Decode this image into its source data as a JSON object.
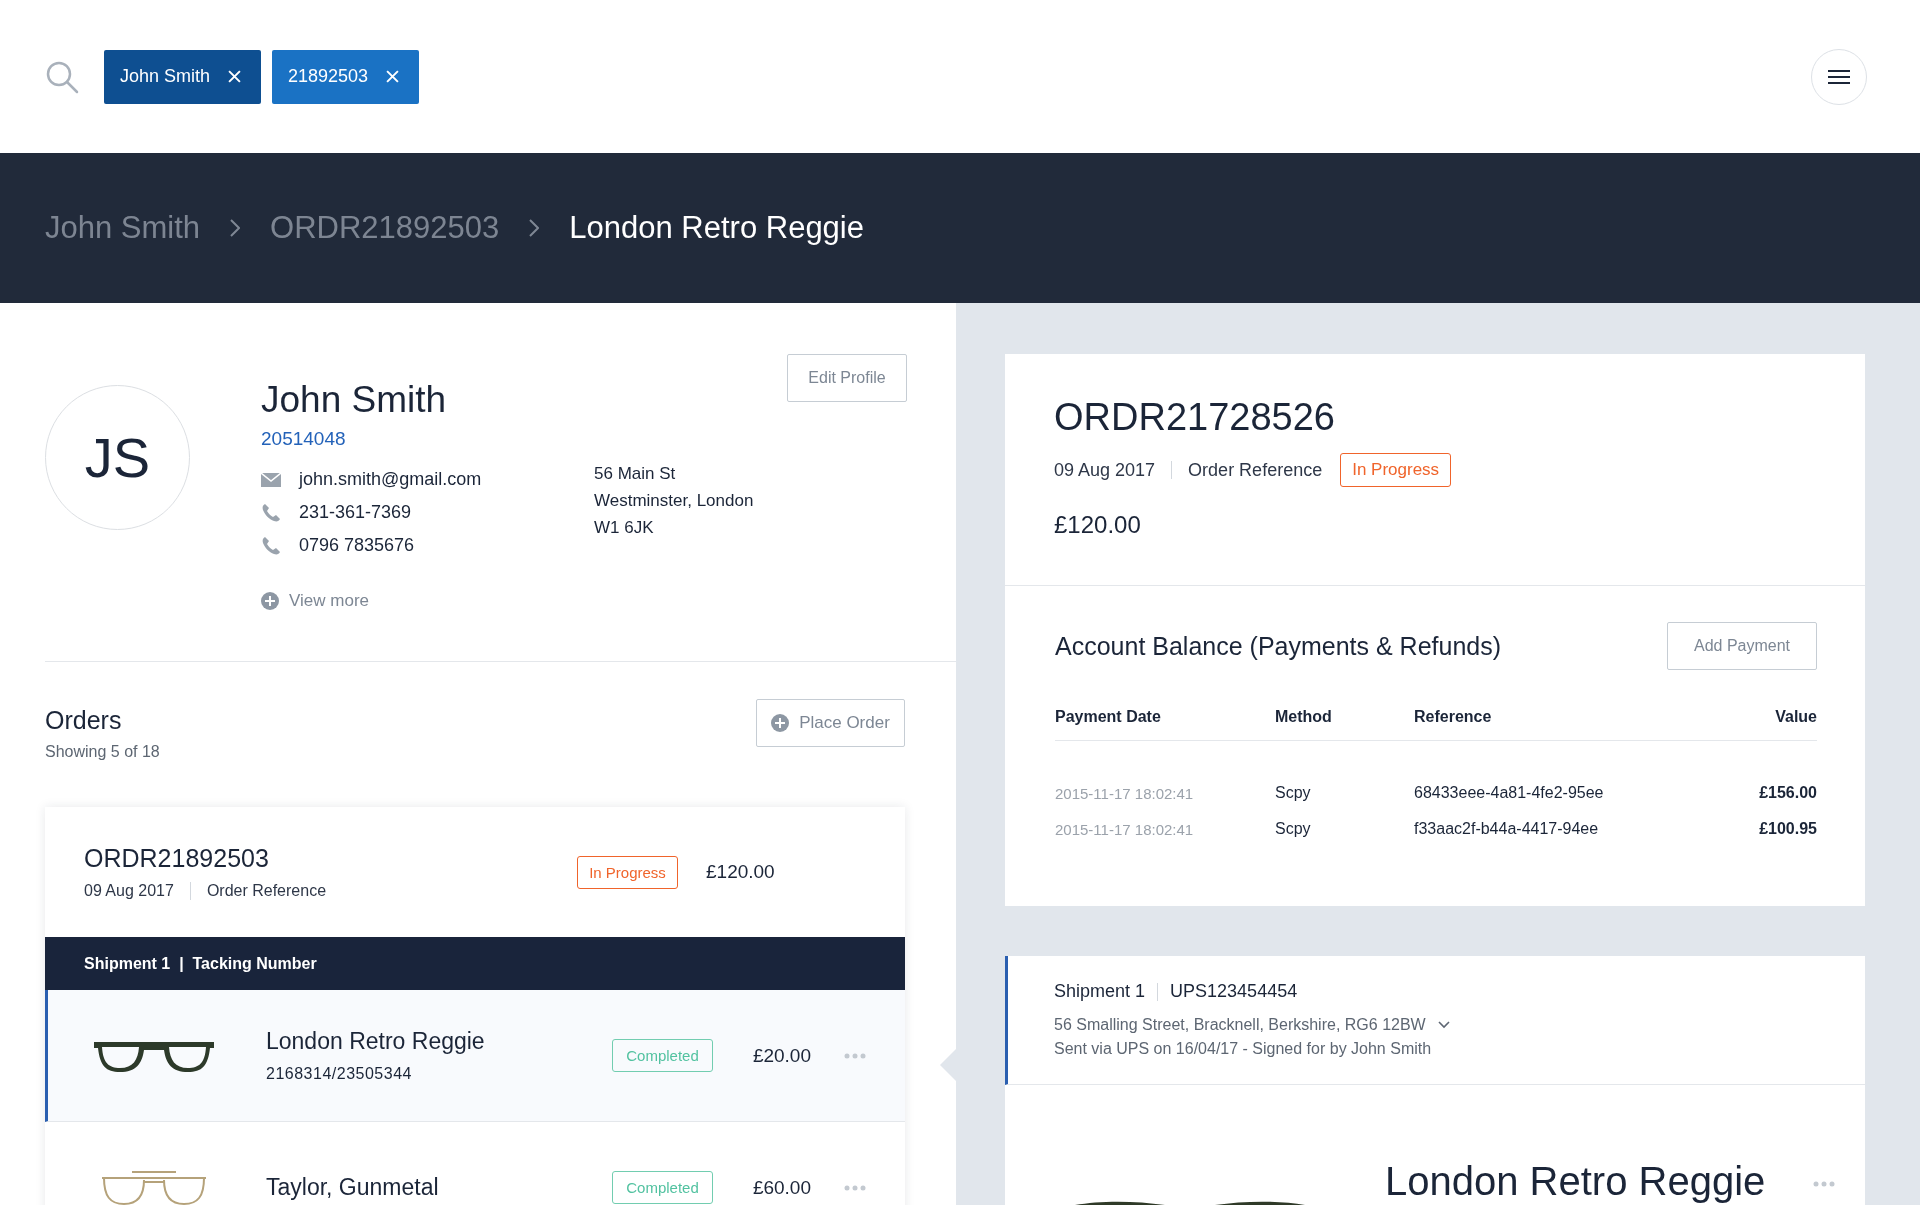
{
  "search_chips": [
    {
      "label": "John Smith",
      "color": "#0e4f91"
    },
    {
      "label": "21892503",
      "color": "#1a72c4"
    }
  ],
  "breadcrumbs": [
    {
      "label": "John Smith",
      "selected": false
    },
    {
      "label": "ORDR21892503",
      "selected": false
    },
    {
      "label": "London Retro Reggie",
      "selected": true
    }
  ],
  "profile": {
    "initials": "JS",
    "name": "John Smith",
    "customer_id": "20514048",
    "edit_button": "Edit Profile",
    "contacts": [
      {
        "kind": "email",
        "text": "john.smith@gmail.com"
      },
      {
        "kind": "phone",
        "text": "231-361-7369"
      },
      {
        "kind": "phone",
        "text": "0796 7835676"
      }
    ],
    "address": [
      "56 Main St",
      "Westminster, London",
      "W1 6JK"
    ],
    "view_more": "View more"
  },
  "orders": {
    "title": "Orders",
    "subtitle": "Showing 5 of 18",
    "place_order": "Place Order",
    "order": {
      "id": "ORDR21892503",
      "date": "09 Aug 2017",
      "reference_label": "Order Reference",
      "status": {
        "label": "In Progress",
        "kind": "in_progress"
      },
      "total": "£120.00",
      "shipment_bar": "Shipment 1  |  Tacking Number",
      "items": [
        {
          "name": "London Retro Reggie",
          "sku": "2168314/23505344",
          "status": {
            "label": "Completed",
            "kind": "completed"
          },
          "price": "£20.00",
          "selected": true,
          "kind": "acetate"
        },
        {
          "name": "Taylor, Gunmetal",
          "status": {
            "label": "Completed",
            "kind": "completed"
          },
          "price": "£60.00",
          "selected": false,
          "kind": "metal"
        }
      ]
    }
  },
  "order_detail": {
    "id": "ORDR21728526",
    "date": "09 Aug 2017",
    "reference_label": "Order Reference",
    "status": {
      "label": "In Progress",
      "kind": "in_progress"
    },
    "total": "£120.00"
  },
  "payments": {
    "title": "Account Balance (Payments & Refunds)",
    "add_button": "Add Payment",
    "columns": [
      "Payment Date",
      "Method",
      "Reference",
      "Value"
    ],
    "rows": [
      [
        "2015-11-17 18:02:41",
        "Scpy",
        "68433eee-4a81-4fe2-95ee",
        "£156.00"
      ],
      [
        "2015-11-17 18:02:41",
        "Scpy",
        "f33aac2f-b44a-4417-94ee",
        "£100.95"
      ]
    ]
  },
  "shipment": {
    "title": "Shipment 1",
    "tracking": "UPS123454454",
    "address": "56 Smalling Street, Bracknell, Berkshire, RG6 12BW",
    "sent": "Sent via UPS on 16/04/17 -  Signed for by John Smith",
    "item_name": "London Retro Reggie"
  }
}
